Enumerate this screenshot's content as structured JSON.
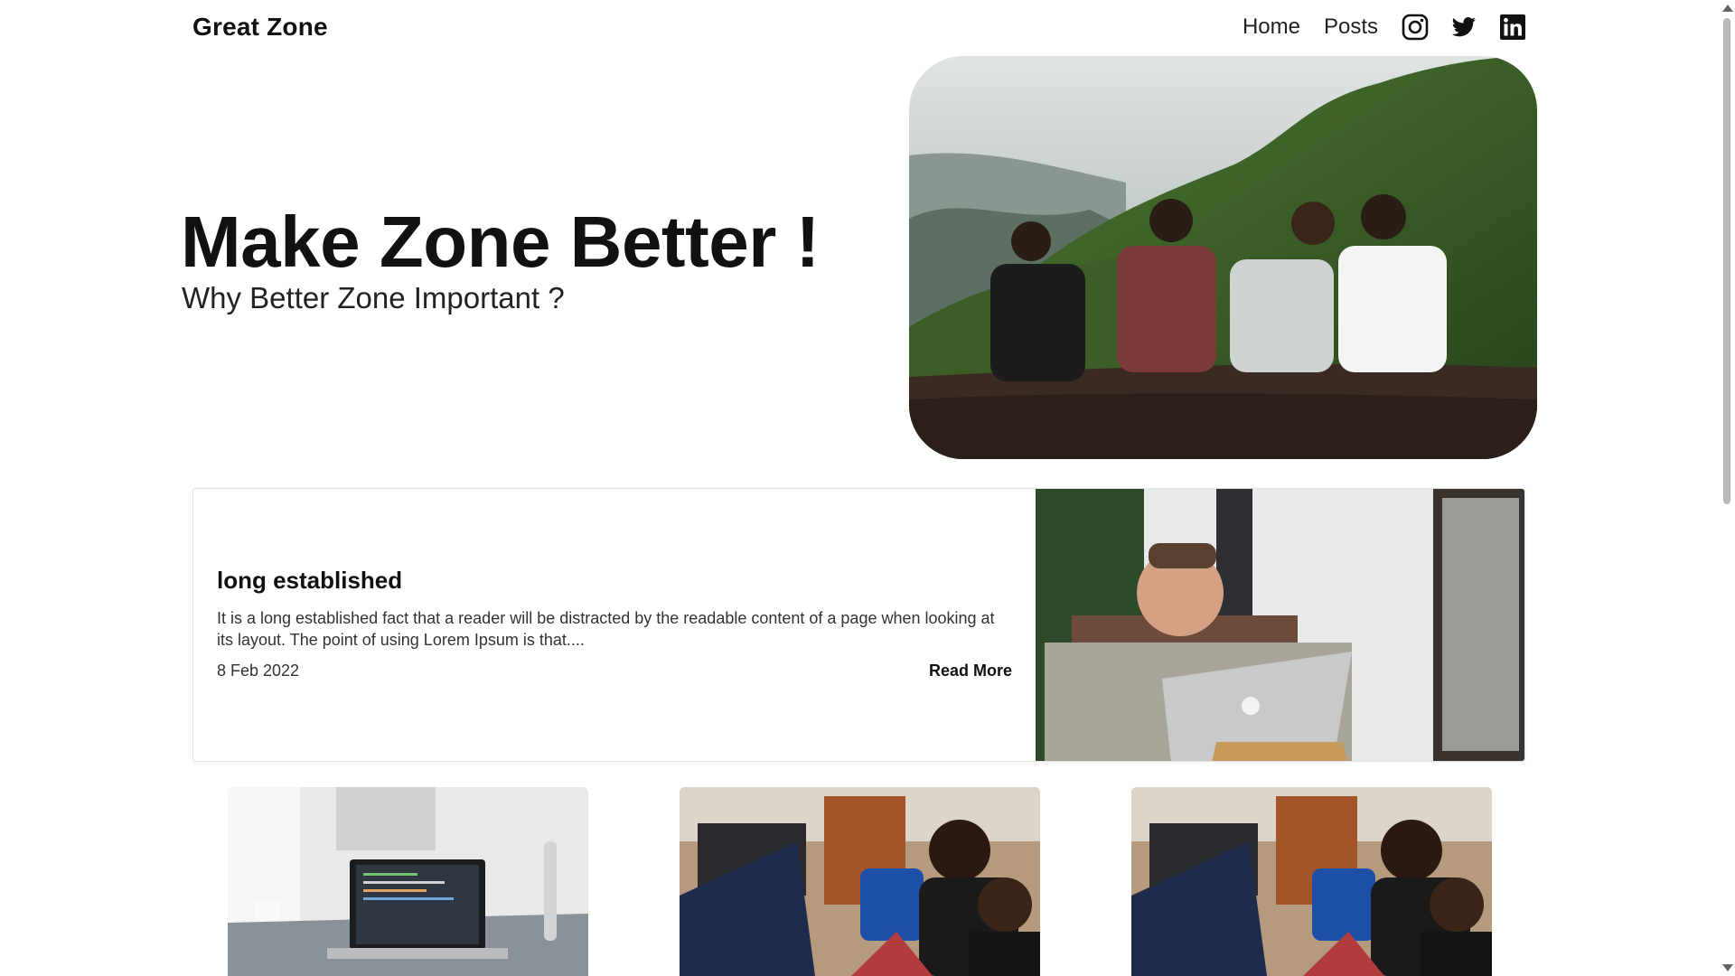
{
  "header": {
    "brand": "Great Zone",
    "nav": [
      {
        "label": "Home"
      },
      {
        "label": "Posts"
      }
    ],
    "social_icons": [
      "instagram-icon",
      "twitter-icon",
      "linkedin-icon"
    ]
  },
  "hero": {
    "title": "Make Zone Better !",
    "subtitle": "Why Better Zone Important ?",
    "image": "friends-on-hillside-photo"
  },
  "featured_post": {
    "title": "long established",
    "excerpt": "It is a long established fact that a reader will be distracted by the readable content of a page when looking at its layout. The point of using Lorem Ipsum is that....",
    "date": "8 Feb 2022",
    "read_more": "Read More",
    "image": "man-with-laptop-photo"
  },
  "posts": [
    {
      "image": "laptop-on-desk-photo"
    },
    {
      "image": "people-working-laptops-photo"
    },
    {
      "image": "people-working-laptops-photo"
    }
  ],
  "colors": {
    "text": "#111111",
    "background": "#ffffff",
    "card_border": "#e2e2e2"
  }
}
